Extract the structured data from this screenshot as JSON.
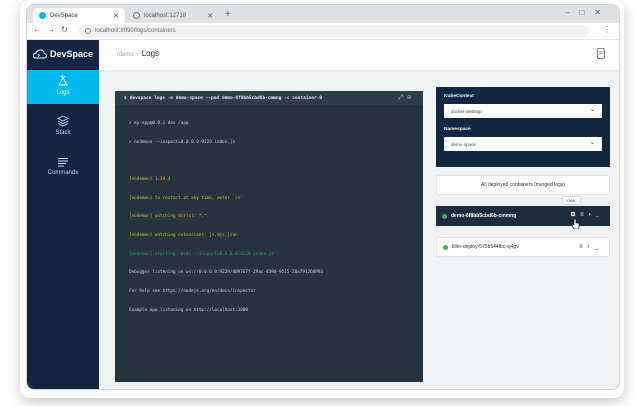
{
  "browser": {
    "tabs": [
      {
        "title": "DevSpace",
        "active": true
      },
      {
        "title": "localhost:12718",
        "active": false
      }
    ],
    "url": "localhost:8090/logs/containers"
  },
  "sidebar": {
    "brand": "DevSpace",
    "items": [
      {
        "label": "Logs",
        "icon": "satellite-icon",
        "active": true
      },
      {
        "label": "Stack",
        "icon": "layers-icon",
        "active": false
      },
      {
        "label": "Commands",
        "icon": "list-icon",
        "active": false
      }
    ]
  },
  "header": {
    "breadcrumb_root": "/demo",
    "title": "Logs"
  },
  "terminal": {
    "command": "devspace logs -n demo-space --pod demo-6f8bb5cbd6b-cmmng -c container-0",
    "lines": [
      {
        "text": "> my-app@0.0.1 dev /app",
        "color": "default"
      },
      {
        "text": "> nodemon --inspect=0.0.0.0:9229 index.js",
        "color": "default"
      },
      {
        "text": "",
        "color": "default"
      },
      {
        "text": "[nodemon] 1.19.4",
        "color": "y"
      },
      {
        "text": "[nodemon] to restart at any time, enter `rs`",
        "color": "y"
      },
      {
        "text": "[nodemon] watching dir(s): *.*",
        "color": "y"
      },
      {
        "text": "[nodemon] watching extensions: js,mjs,json",
        "color": "y"
      },
      {
        "text": "[nodemon] starting `node --inspect=0.0.0.0:9229 index.js`",
        "color": "g"
      },
      {
        "text": "Debugger listening on ws://0.0.0.0:9229/d09767f-29ac-4390-9515-20a79126d993",
        "color": "default"
      },
      {
        "text": "For help see https://nodejs.org/en/docs/inspector",
        "color": "default"
      },
      {
        "text": "Example app listening on http://localhost:3000",
        "color": "default"
      }
    ]
  },
  "context_panel": {
    "kube_label": "KubeContext",
    "kube_value": "docker-desktop",
    "ns_label": "Namespace",
    "ns_value": "demo-space"
  },
  "containers": {
    "all_button": "All deployed containers (merged logs)",
    "pods": [
      {
        "name": "demo-6f8bb5cbd6b-cmmng",
        "status": "running",
        "selected": true
      },
      {
        "name": "tiller-deploy-575b544fbc-xj4gv",
        "status": "running",
        "selected": false
      }
    ],
    "tooltip": "YAML"
  },
  "colors": {
    "sidebar": "#132642",
    "accent": "#00b9ec",
    "terminal_bg": "#25343e",
    "status_green": "#3cb54a"
  }
}
